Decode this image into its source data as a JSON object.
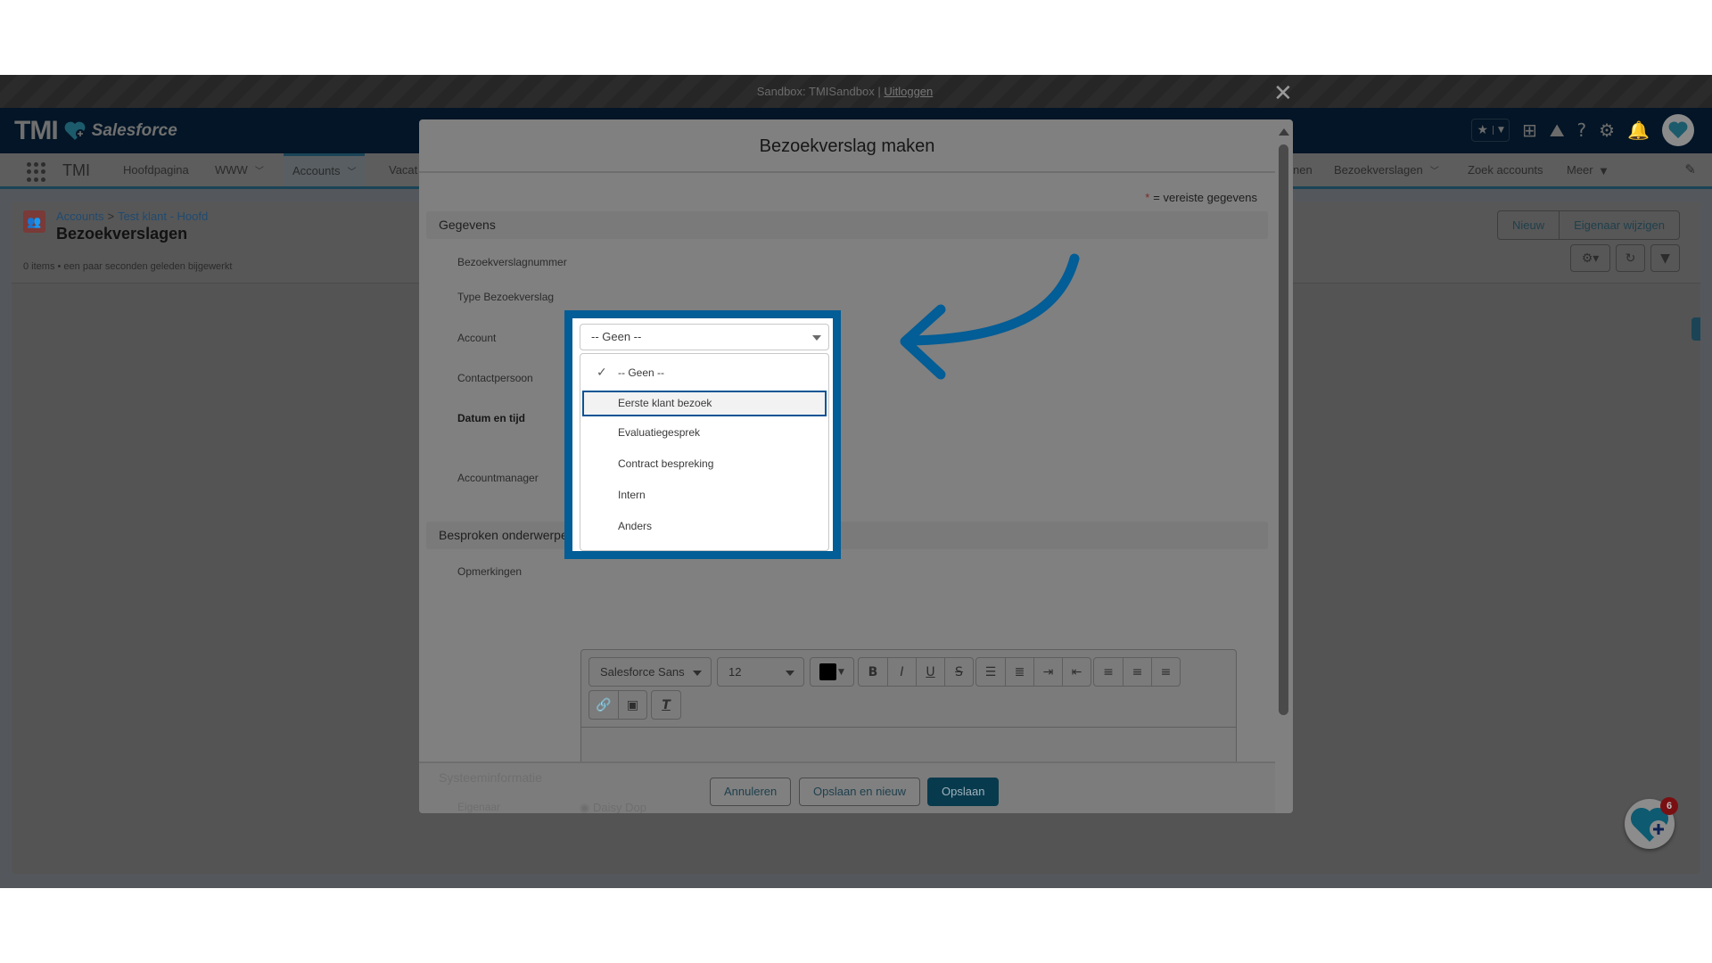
{
  "sandbox_bar": {
    "text": "Sandbox: TMISandbox |",
    "logout_link": "Uitloggen",
    "close_glyph": "✕"
  },
  "header": {
    "logo_text": "TMI",
    "logo_subtext": "Salesforce",
    "icons": [
      "star-icon",
      "chevron-down-icon",
      "add-icon",
      "trailhead-icon",
      "help-icon",
      "gear-icon",
      "bell-icon",
      "avatar"
    ]
  },
  "nav": {
    "app_name": "TMI",
    "items": [
      {
        "label": "Hoofdpagina",
        "has_menu": false
      },
      {
        "label": "WWW",
        "has_menu": true
      },
      {
        "label": "Accounts",
        "has_menu": true,
        "active": true
      },
      {
        "label": "Vacat",
        "has_menu": false
      },
      {
        "label": "nen",
        "has_menu": false
      },
      {
        "label": "Bezoekverslagen",
        "has_menu": true
      },
      {
        "label": "Zoek accounts",
        "has_menu": false
      },
      {
        "label": "Meer",
        "has_menu": true
      }
    ]
  },
  "list_view": {
    "breadcrumb": [
      "Accounts",
      "Test klant - Hoofd"
    ],
    "breadcrumb_separator": ">",
    "title": "Bezoekverslagen",
    "meta": "0 items • een paar seconden geleden bijgewerkt",
    "buttons": {
      "new": "Nieuw",
      "change_owner": "Eigenaar wijzigen"
    }
  },
  "modal": {
    "title": "Bezoekverslag maken",
    "required_note": "= vereiste gegevens",
    "required_star": "*",
    "section_details": "Gegevens",
    "section_topics": "Besproken onderwerpen",
    "section_system": "Systeeminformatie",
    "fields": {
      "number": "Bezoekverslagnummer",
      "type": "Type Bezoekverslag",
      "account": "Account",
      "contact": "Contactpersoon",
      "datetime": "Datum en tijd",
      "manager": "Accountmanager",
      "remarks": "Opmerkingen",
      "owner": "Eigenaar"
    },
    "owner_value": "Daisy Dop",
    "type_select": {
      "value": "-- Geen --",
      "options": [
        {
          "label": "-- Geen --",
          "selected": true,
          "hovered": false
        },
        {
          "label": "Eerste klant bezoek",
          "selected": false,
          "hovered": true
        },
        {
          "label": "Evaluatiegesprek",
          "selected": false,
          "hovered": false
        },
        {
          "label": "Contract bespreking",
          "selected": false,
          "hovered": false
        },
        {
          "label": "Intern",
          "selected": false,
          "hovered": false
        },
        {
          "label": "Anders",
          "selected": false,
          "hovered": false
        }
      ]
    },
    "editor": {
      "font": "Salesforce Sans",
      "size": "12",
      "text_color": "#000000",
      "buttons": [
        "B",
        "I",
        "U",
        "S"
      ]
    },
    "footer": {
      "cancel": "Annuleren",
      "save_new": "Opslaan en nieuw",
      "save": "Opslaan"
    }
  },
  "fab": {
    "badge_count": "6"
  },
  "colors": {
    "highlight": "#035d96",
    "brand_button": "#083a4d",
    "header_bg": "#031526"
  }
}
